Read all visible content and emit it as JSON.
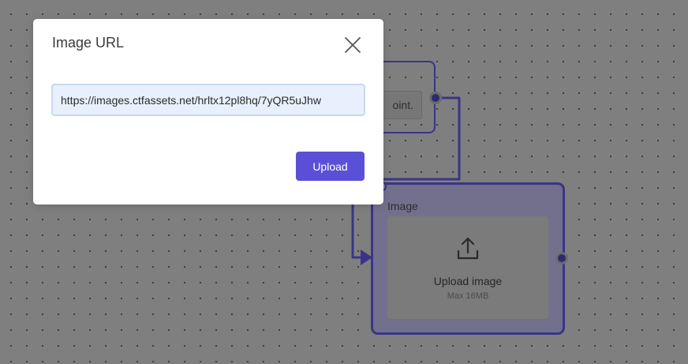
{
  "modal": {
    "title": "Image URL",
    "url_value": "https://images.ctfassets.net/hrltx12pl8hq/7yQR5uJhw",
    "upload_label": "Upload",
    "close_icon": "close-icon"
  },
  "canvas": {
    "prev_node": {
      "field_fragment": "oint."
    },
    "image_node": {
      "title": "Image",
      "upload_label": "Upload image",
      "upload_limit": "Max 16MB",
      "upload_icon": "upload-icon"
    }
  },
  "colors": {
    "accent": "#5a50d8",
    "node_border": "#3a3489",
    "canvas_bg": "#7f7f7f",
    "input_bg": "#e8f0fd"
  }
}
